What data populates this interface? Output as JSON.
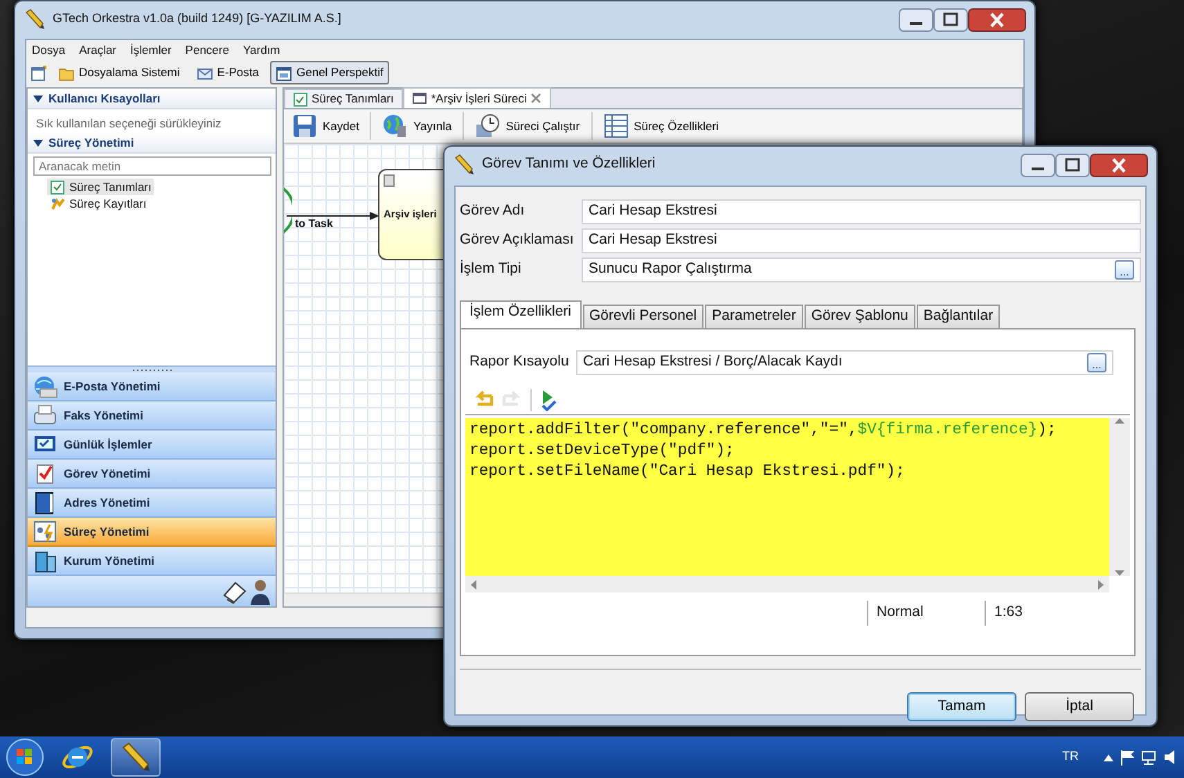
{
  "main_window": {
    "title": "GTech Orkestra v1.0a (build 1249) [G-YAZILIM A.S.]",
    "menu": [
      "Dosya",
      "Araçlar",
      "İşlemler",
      "Pencere",
      "Yardım"
    ],
    "toolbar": [
      {
        "label": "Dosyalama Sistemi",
        "kind": "folder",
        "selected": false
      },
      {
        "label": "E-Posta",
        "kind": "mail",
        "selected": false
      },
      {
        "label": "Genel Perspektif",
        "kind": "perspective",
        "selected": true
      }
    ],
    "shortcuts": {
      "title": "Kullanıcı Kısayolları",
      "expanded": true,
      "hint": "Sık kullanılan seçeneği sürükleyiniz"
    },
    "process_section": {
      "title": "Süreç Yönetimi",
      "expanded": true,
      "search_placeholder": "Aranacak metin",
      "items": [
        {
          "label": "Süreç Tanımları",
          "selected": true
        },
        {
          "label": "Süreç Kayıtları",
          "selected": false
        }
      ]
    },
    "modules": [
      {
        "label": "E-Posta Yönetimi",
        "selected": false
      },
      {
        "label": "Faks Yönetimi",
        "selected": false
      },
      {
        "label": "Günlük İşlemler",
        "selected": false
      },
      {
        "label": "Görev Yönetimi",
        "selected": false
      },
      {
        "label": "Adres Yönetimi",
        "selected": false
      },
      {
        "label": "Süreç Yönetimi",
        "selected": true
      },
      {
        "label": "Kurum Yönetimi",
        "selected": false
      }
    ],
    "editor_tabs": [
      {
        "label": "Süreç Tanımları",
        "selected": false,
        "closable": false
      },
      {
        "label": "*Arşiv İşleri Süreci",
        "selected": true,
        "closable": true
      }
    ],
    "editor_toolbar": [
      {
        "label": "Kaydet",
        "kind": "save"
      },
      {
        "label": "Yayınla",
        "kind": "publish"
      },
      {
        "label": "Süreci Çalıştır",
        "kind": "run"
      },
      {
        "label": "Süreç Özellikleri",
        "kind": "properties"
      }
    ],
    "diagram": {
      "edge_label": "to Task",
      "task_label": "Arşiv işleri"
    }
  },
  "dialog": {
    "title": "Görev Tanımı ve Özellikleri",
    "fields": [
      {
        "label": "Görev Adı",
        "value": "Cari Hesap Ekstresi"
      },
      {
        "label": "Görev Açıklaması",
        "value": "Cari Hesap Ekstresi"
      },
      {
        "label": "İşlem Tipi",
        "value": "Sunucu Rapor Çalıştırma",
        "browse": "..."
      }
    ],
    "tabs": [
      {
        "label": "İşlem Özellikleri",
        "selected": true
      },
      {
        "label": "Görevli Personel",
        "selected": false
      },
      {
        "label": "Parametreler",
        "selected": false
      },
      {
        "label": "Görev Şablonu",
        "selected": false
      },
      {
        "label": "Bağlantılar",
        "selected": false
      }
    ],
    "report_shortcut": {
      "label": "Rapor Kısayolu",
      "value": "Cari Hesap Ekstresi / Borç/Alacak Kaydı",
      "browse": "..."
    },
    "code_tools": [
      {
        "kind": "undo",
        "disabled": false
      },
      {
        "kind": "redo",
        "disabled": true
      },
      {
        "kind": "run",
        "disabled": false
      }
    ],
    "code_lines": [
      [
        {
          "kind": "plain",
          "text": "report.addFilter(\"company.reference\",\"=\","
        },
        {
          "kind": "variable",
          "text": "$V{firma.reference}"
        },
        {
          "kind": "plain",
          "text": ");"
        }
      ],
      [
        {
          "kind": "plain",
          "text": "report.setDeviceType(\"pdf\");"
        }
      ],
      [
        {
          "kind": "plain",
          "text": "report.setFileName(\"Cari Hesap Ekstresi.pdf\");"
        }
      ]
    ],
    "status": {
      "mode": "Normal",
      "position": "1:63"
    },
    "buttons": [
      {
        "label": "Tamam",
        "default": true
      },
      {
        "label": "İptal",
        "default": false
      }
    ]
  },
  "taskbar": {
    "language": "TR",
    "apps": [
      {
        "kind": "browser",
        "active": false
      },
      {
        "kind": "orkestra",
        "active": true
      }
    ]
  }
}
